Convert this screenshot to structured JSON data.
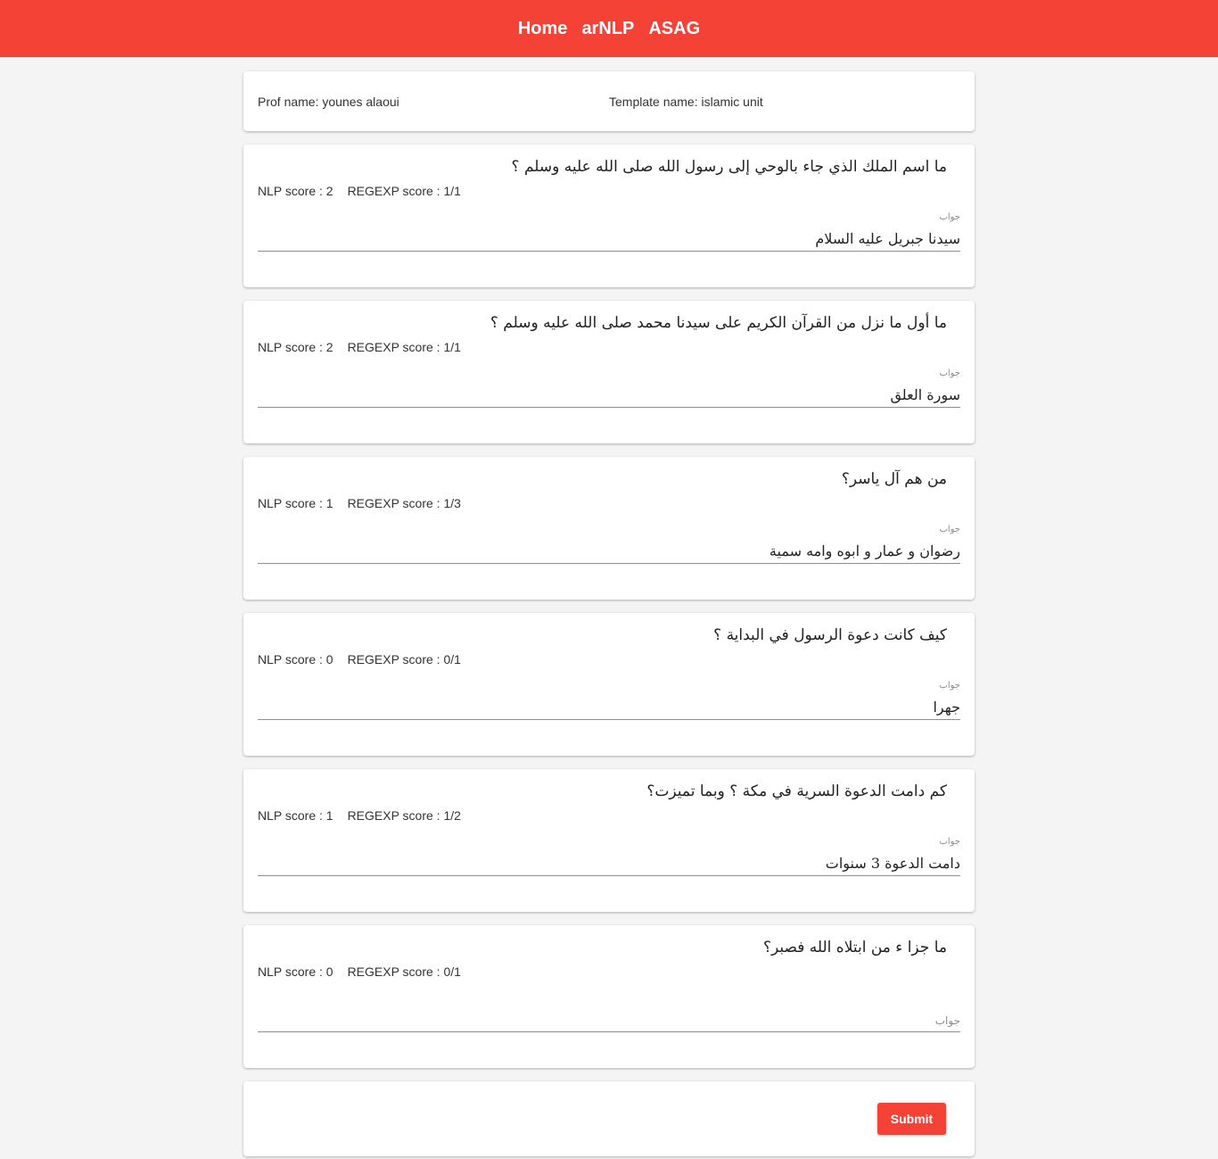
{
  "nav": {
    "items": [
      {
        "label": "Home"
      },
      {
        "label": "arNLP"
      },
      {
        "label": "ASAG"
      }
    ]
  },
  "info": {
    "prof": "Prof name: younes alaoui",
    "template": "Template name: islamic unit"
  },
  "questions": [
    {
      "question": "ما اسم الملك الذي جاء بالوحي إلى رسول الله صلى الله عليه وسلم ؟",
      "nlp": "NLP score : 2",
      "regexp": "REGEXP score : 1/1",
      "label": "جواب",
      "answer": "سيدنا جبريل عليه السلام"
    },
    {
      "question": "ما أول ما نزل من القرآن الكريم على سيدنا محمد صلى الله عليه وسلم ؟",
      "nlp": "NLP score : 2",
      "regexp": "REGEXP score : 1/1",
      "label": "جواب",
      "answer": "سورة العلق"
    },
    {
      "question": "من هم آل ياسر؟",
      "nlp": "NLP score : 1",
      "regexp": "REGEXP score : 1/3",
      "label": "جواب",
      "answer": "رضوان و عمار و ابوه وامه سمية"
    },
    {
      "question": "كيف كانت دعوة الرسول في البداية ؟",
      "nlp": "NLP score : 0",
      "regexp": "REGEXP score : 0/1",
      "label": "جواب",
      "answer": "جهرا"
    },
    {
      "question": "كم دامت الدعوة السرية في مكة ؟ وبما تميزت؟",
      "nlp": "NLP score : 1",
      "regexp": "REGEXP score : 1/2",
      "label": "جواب",
      "answer": "دامت الدعوة 3 سنوات"
    },
    {
      "question": "ما جزا ء من ابتلاه الله فصبر؟",
      "nlp": "NLP score : 0",
      "regexp": "REGEXP score : 0/1",
      "label": "جواب",
      "answer": ""
    }
  ],
  "submit_label": "Submit",
  "colors": {
    "accent": "#f44336",
    "background": "#f4f4f4"
  }
}
